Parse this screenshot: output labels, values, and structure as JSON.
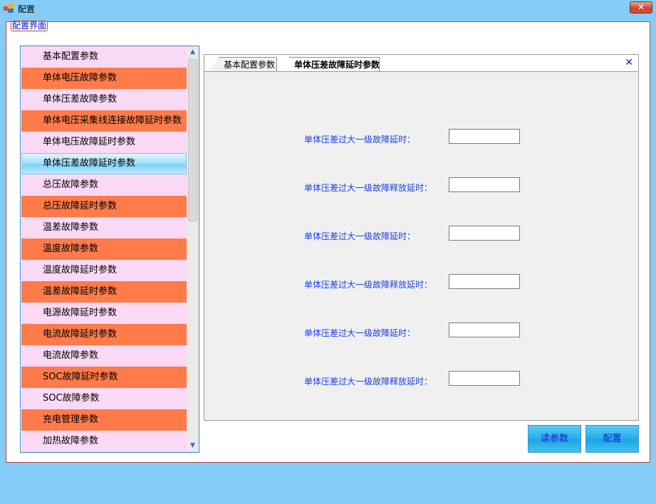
{
  "window": {
    "title": "配置",
    "close_label": "✕"
  },
  "group": {
    "legend": "配置界面"
  },
  "sidebar": {
    "items": [
      {
        "label": "基本配置参数"
      },
      {
        "label": "单体电压故障参数"
      },
      {
        "label": "单体压差故障参数"
      },
      {
        "label": "单体电压采集线连接故障延时参数"
      },
      {
        "label": "单体电压故障延时参数"
      },
      {
        "label": "单体压差故障延时参数"
      },
      {
        "label": "总压故障参数"
      },
      {
        "label": "总压故障延时参数"
      },
      {
        "label": "温差故障参数"
      },
      {
        "label": "温度故障参数"
      },
      {
        "label": "温度故障延时参数"
      },
      {
        "label": "温差故障延时参数"
      },
      {
        "label": "电源故障延时参数"
      },
      {
        "label": "电流故障延时参数"
      },
      {
        "label": "电流故障参数"
      },
      {
        "label": "SOC故障延时参数"
      },
      {
        "label": "SOC故障参数"
      },
      {
        "label": "充电管理参数"
      },
      {
        "label": "加热故障参数"
      }
    ],
    "selected_index": 5,
    "scroll_up": "▲",
    "scroll_down": "▼"
  },
  "tabs": [
    {
      "label": "基本配置参数"
    },
    {
      "label": "单体压差故障延时参数"
    }
  ],
  "active_tab": 1,
  "tab_close": "✕",
  "params": [
    {
      "label": "单体压差过大一级故障延时：",
      "value": ""
    },
    {
      "label": "单体压差过大一级故障释放延时：",
      "value": ""
    },
    {
      "label": "单体压差过大一级故障延时：",
      "value": ""
    },
    {
      "label": "单体压差过大一级故障释放延时：",
      "value": ""
    },
    {
      "label": "单体压差过大一级故障延时：",
      "value": ""
    },
    {
      "label": "单体压差过大一级故障释放延时：",
      "value": ""
    }
  ],
  "buttons": {
    "read_label": "读参数",
    "config_label": "配置"
  },
  "colors": {
    "background": "#85cdf9",
    "item_pink": "#fad9f5",
    "item_orange": "#ff7b4a",
    "label_blue": "#1b3fe0"
  }
}
